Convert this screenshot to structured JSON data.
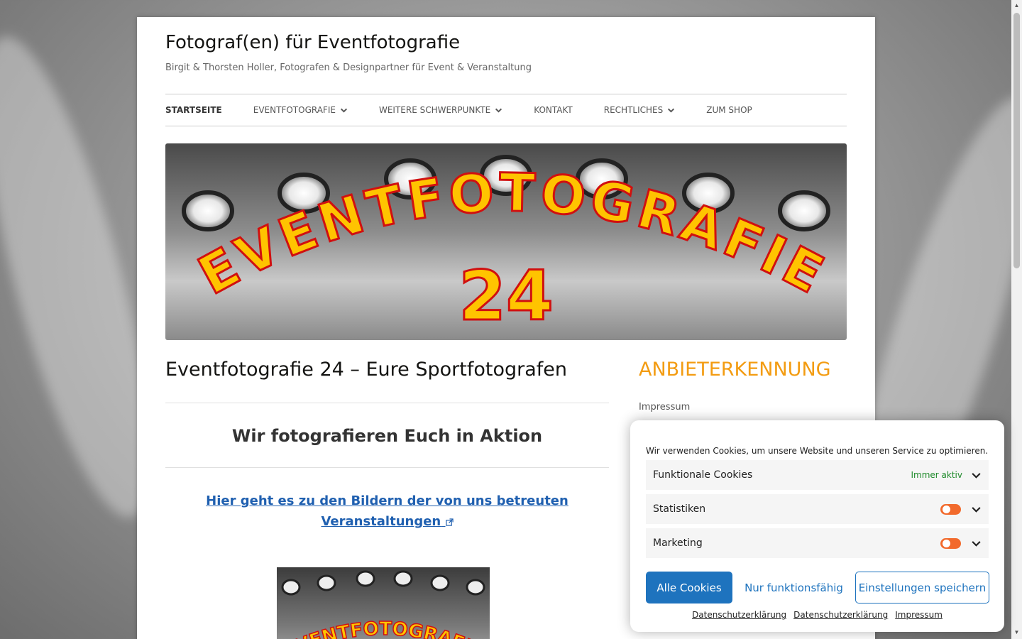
{
  "site": {
    "title": "Fotograf(en) für Eventfotografie",
    "description": "Birgit & Thorsten Holler, Fotografen & Designpartner für Event & Veranstaltung"
  },
  "nav": {
    "items": [
      {
        "label": "Startseite",
        "has_dropdown": false,
        "active": true
      },
      {
        "label": "Eventfotografie",
        "has_dropdown": true,
        "active": false
      },
      {
        "label": "Weitere Schwerpunkte",
        "has_dropdown": true,
        "active": false
      },
      {
        "label": "Kontakt",
        "has_dropdown": false,
        "active": false
      },
      {
        "label": "Rechtliches",
        "has_dropdown": true,
        "active": false
      },
      {
        "label": "Zum Shop",
        "has_dropdown": false,
        "active": false
      }
    ]
  },
  "banner": {
    "logo_text": "EVENTFOTOGRAFIE",
    "logo_number": "24"
  },
  "main": {
    "title": "Eventfotografie 24 – Eure Sportfotografen",
    "subtitle": "Wir fotografieren Euch in Aktion",
    "link_text": "Hier geht es zu den Bildern der von uns betreuten Veranstaltungen",
    "thumb_text": "EVENTFOTOGRAFIE"
  },
  "sidebar": {
    "widget_title": "Anbieterkennung",
    "links": [
      "Impressum"
    ]
  },
  "cookie_banner": {
    "message": "Wir verwenden Cookies, um unsere Website und unseren Service zu optimieren.",
    "categories": [
      {
        "label": "Funktionale Cookies",
        "status": "Immer aktiv"
      },
      {
        "label": "Statistiken",
        "status": ""
      },
      {
        "label": "Marketing",
        "status": ""
      }
    ],
    "buttons": {
      "accept_all": "Alle Cookies",
      "functional_only": "Nur funktionsfähig",
      "save": "Einstellungen speichern"
    },
    "links": [
      "Datenschutzerklärung",
      "Datenschutzerklärung",
      "Impressum"
    ]
  },
  "colors": {
    "accent": "#1e73be",
    "widget_title": "#f39c12",
    "toggle": "#f26a2c",
    "always_active": "#1e8a2a",
    "logo_fill": "#ffc400",
    "logo_stroke": "#d01010"
  }
}
